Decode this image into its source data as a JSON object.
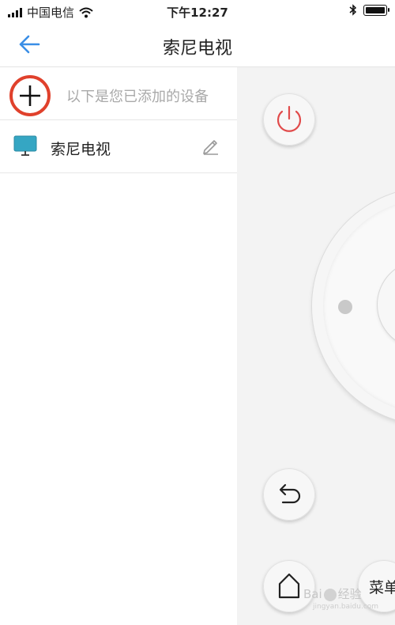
{
  "status_bar": {
    "carrier": "中国电信",
    "time": "下午12:27"
  },
  "nav": {
    "title": "索尼电视"
  },
  "device_list": {
    "add_hint": "以下是您已添加的设备",
    "devices": [
      {
        "name": "索尼电视"
      }
    ]
  },
  "remote": {
    "menu_label": "菜单"
  },
  "watermark": {
    "text": "Bai",
    "text2": "经验",
    "sub": "jingyan.baidu.com"
  },
  "colors": {
    "accent_blue": "#3a8ee6",
    "add_ring_red": "#e0412c",
    "power_red": "#e14b4b",
    "tv_teal": "#35a6c3"
  }
}
